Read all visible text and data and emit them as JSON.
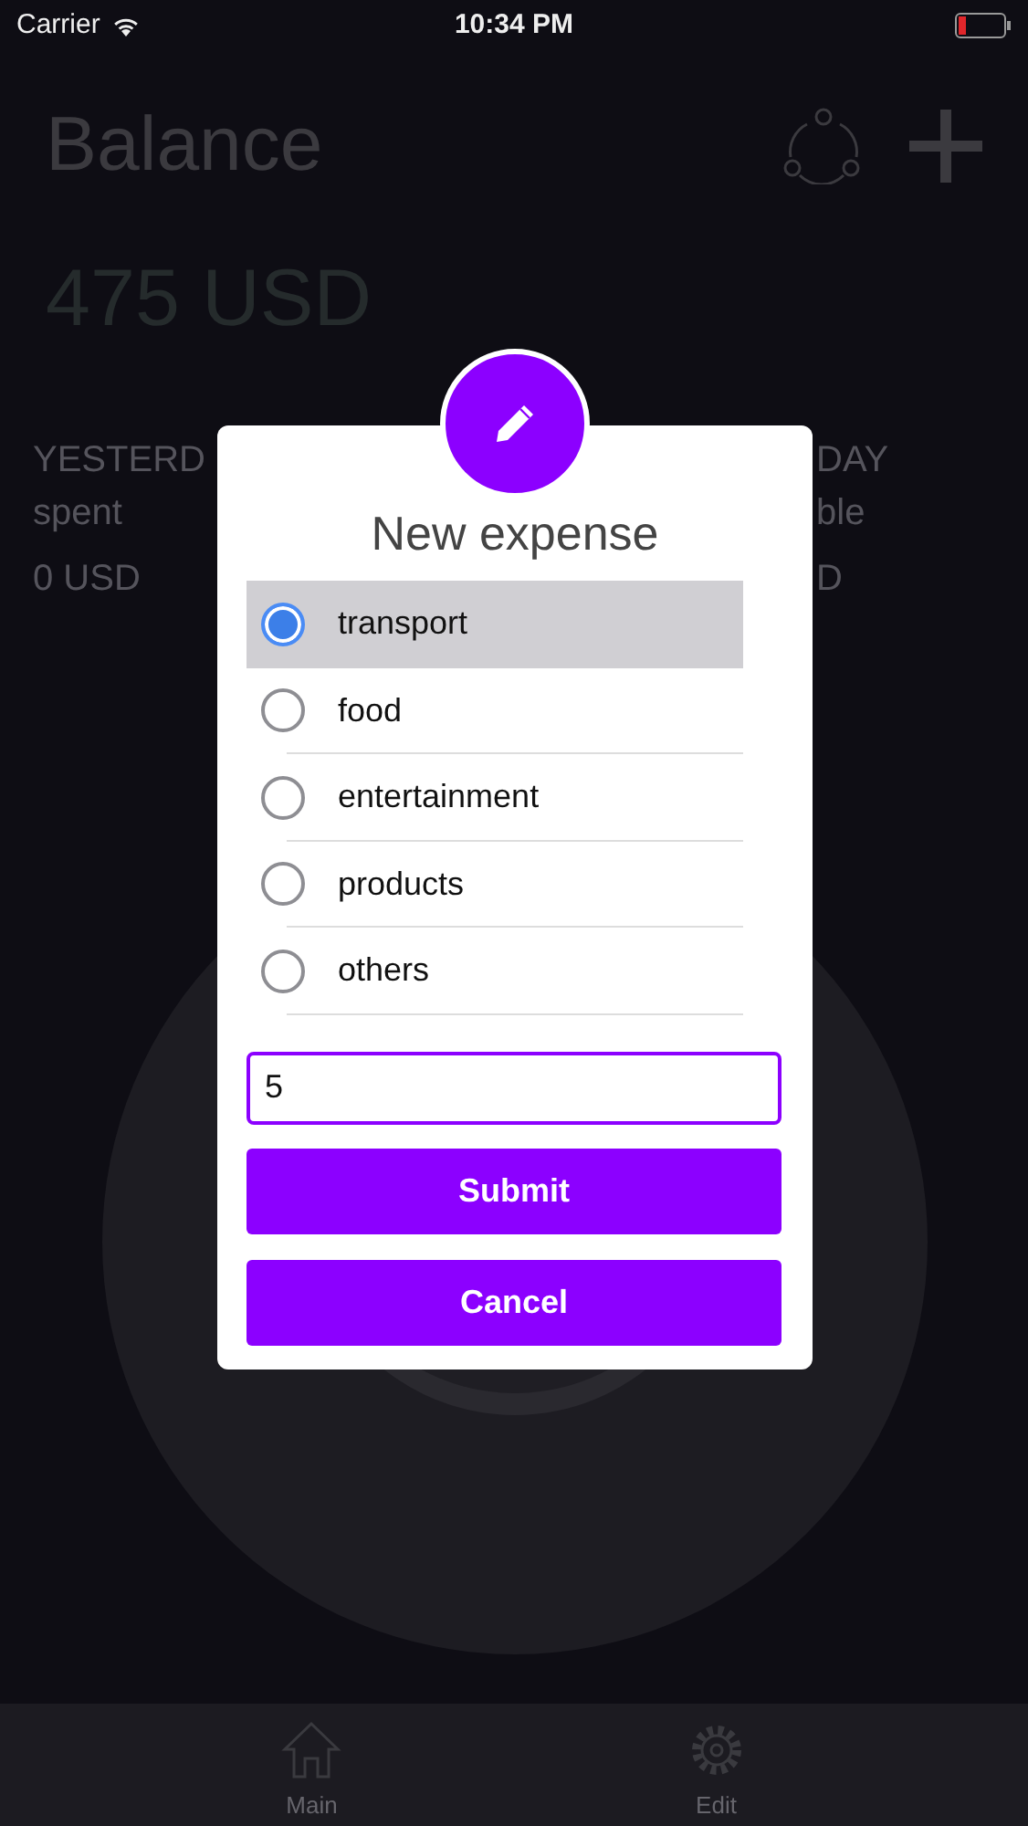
{
  "status_bar": {
    "carrier": "Carrier",
    "time": "10:34 PM"
  },
  "background": {
    "title": "Balance",
    "balance": "475 USD",
    "left_stat": {
      "heading": "YESTERD",
      "label": "spent",
      "value": "0 USD"
    },
    "right_stat": {
      "heading": "DAY",
      "label": "ble",
      "value": "D"
    }
  },
  "dialog": {
    "title": "New expense",
    "options": [
      {
        "label": "transport",
        "selected": true
      },
      {
        "label": "food",
        "selected": false
      },
      {
        "label": "entertainment",
        "selected": false
      },
      {
        "label": "products",
        "selected": false
      },
      {
        "label": "others",
        "selected": false
      }
    ],
    "amount": {
      "value": "5"
    },
    "buttons": [
      {
        "label": "Submit"
      },
      {
        "label": "Cancel"
      }
    ]
  },
  "tab_bar": {
    "tabs": [
      {
        "label": "Main",
        "kind": "home"
      },
      {
        "label": "Edit",
        "kind": "gear"
      }
    ]
  }
}
